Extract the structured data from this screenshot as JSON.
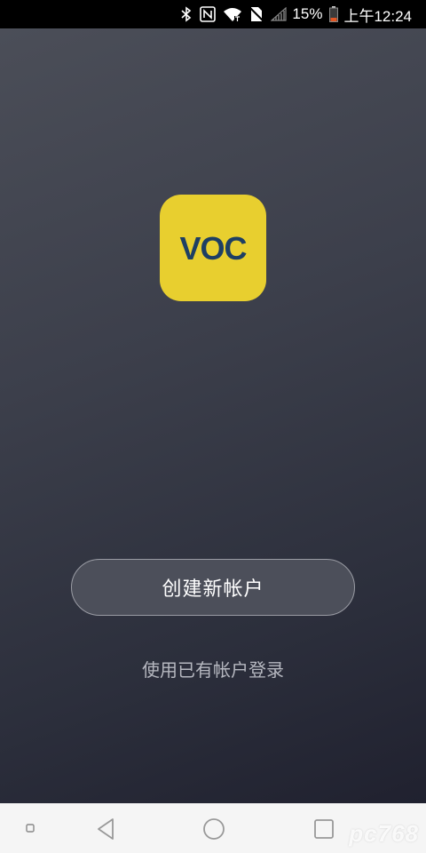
{
  "status_bar": {
    "icons": [
      "bluetooth-icon",
      "nfc-icon",
      "wifi-icon",
      "no-sim-icon",
      "signal-icon"
    ],
    "battery_percent": "15%",
    "time": "上午12:24",
    "battery_icon": "battery-low-icon"
  },
  "logo": {
    "text": "VOC",
    "bg_color": "#e8cf2f",
    "text_color": "#1e3f63"
  },
  "actions": {
    "create_account": "创建新帐户",
    "login_existing": "使用已有帐户登录"
  },
  "nav_bar": {
    "items": [
      "recent-dot-icon",
      "back-icon",
      "home-icon",
      "overview-icon"
    ]
  },
  "watermark": "pc768"
}
